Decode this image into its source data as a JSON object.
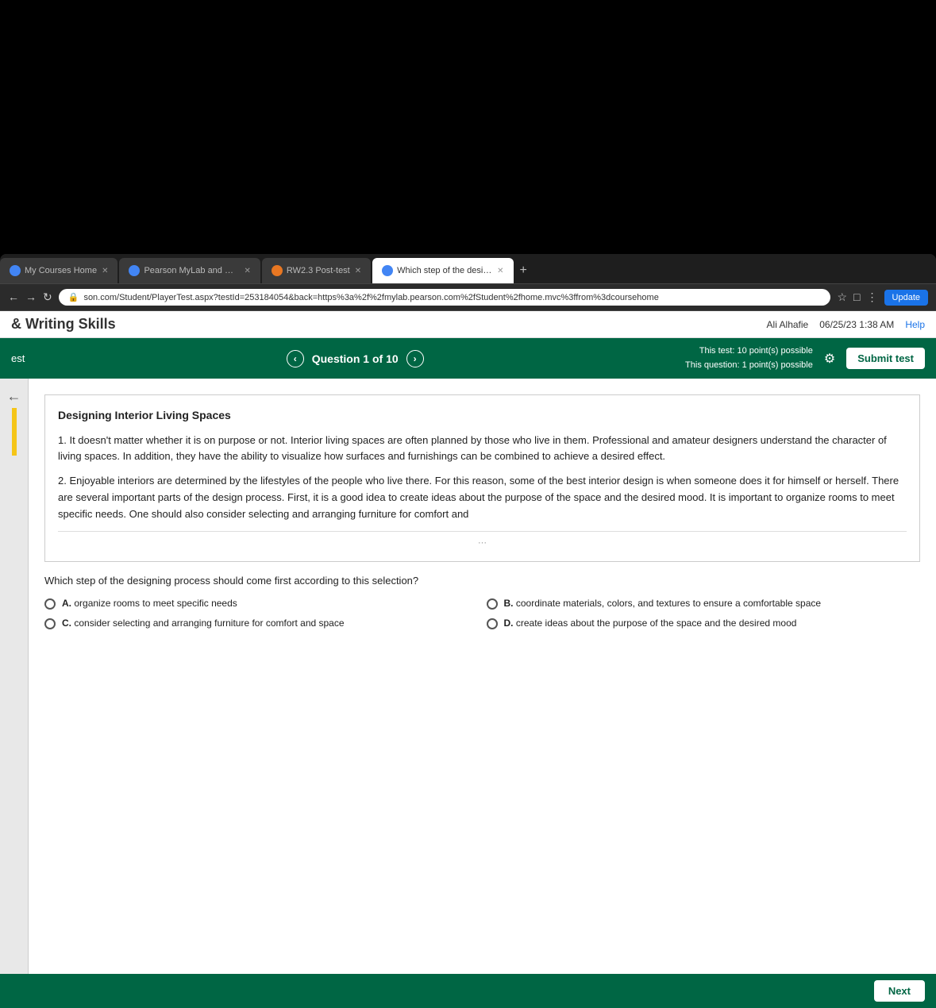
{
  "browser": {
    "tabs": [
      {
        "id": "tab1",
        "label": "My Courses Home",
        "icon": "blue",
        "active": false,
        "closeable": true
      },
      {
        "id": "tab2",
        "label": "Pearson MyLab and Mastering",
        "icon": "blue",
        "active": false,
        "closeable": true
      },
      {
        "id": "tab3",
        "label": "RW2.3 Post-test",
        "icon": "orange",
        "active": false,
        "closeable": true
      },
      {
        "id": "tab4",
        "label": "Which step of the designing p",
        "icon": "blue",
        "active": true,
        "closeable": true
      }
    ],
    "address": "son.com/Student/PlayerTest.aspx?testId=253184054&back=https%3a%2f%2fmylab.pearson.com%2fStudent%2fhome.mvc%3ffrom%3dcoursehome",
    "update_label": "Update"
  },
  "page": {
    "title": "& Writing Skills",
    "user": "Ali Alhafie",
    "date": "06/25/23 1:38 AM",
    "help_label": "Help"
  },
  "test_header": {
    "back_arrow": "‹",
    "question_label": "Question 1 of 10",
    "forward_arrow": "›",
    "test_points": "This test: 10 point(s) possible",
    "question_points": "This question: 1 point(s) possible",
    "submit_label": "Submit test"
  },
  "passage": {
    "title": "Designing Interior Living Spaces",
    "paragraph1": "1. It doesn't matter whether it is on purpose or not. Interior living spaces are often planned by those who live in them. Professional and amateur designers understand the character of living spaces. In addition, they have the ability to visualize how surfaces and furnishings can be combined to achieve a desired effect.",
    "paragraph2": "2. Enjoyable interiors are determined by the lifestyles of the people who live there. For this reason, some of the best interior design is when someone does it for himself or herself. There are several important parts of the design process. First, it is a good idea to create ideas about the purpose of the space and the desired mood. It is important to organize rooms to meet specific needs. One should also consider selecting and arranging furniture for comfort and",
    "more_indicator": "···"
  },
  "question": {
    "text": "Which step of the designing process should come first according to this selection?",
    "options": [
      {
        "id": "A",
        "label": "organize rooms to meet specific needs"
      },
      {
        "id": "B",
        "label": "coordinate materials, colors, and textures to ensure a comfortable space"
      },
      {
        "id": "C",
        "label": "consider selecting and arranging furniture for comfort and space"
      },
      {
        "id": "D",
        "label": "create ideas about the purpose of the space and the desired mood"
      }
    ]
  },
  "footer": {
    "next_label": "Next"
  },
  "sidebar": {
    "arrow": "←"
  }
}
